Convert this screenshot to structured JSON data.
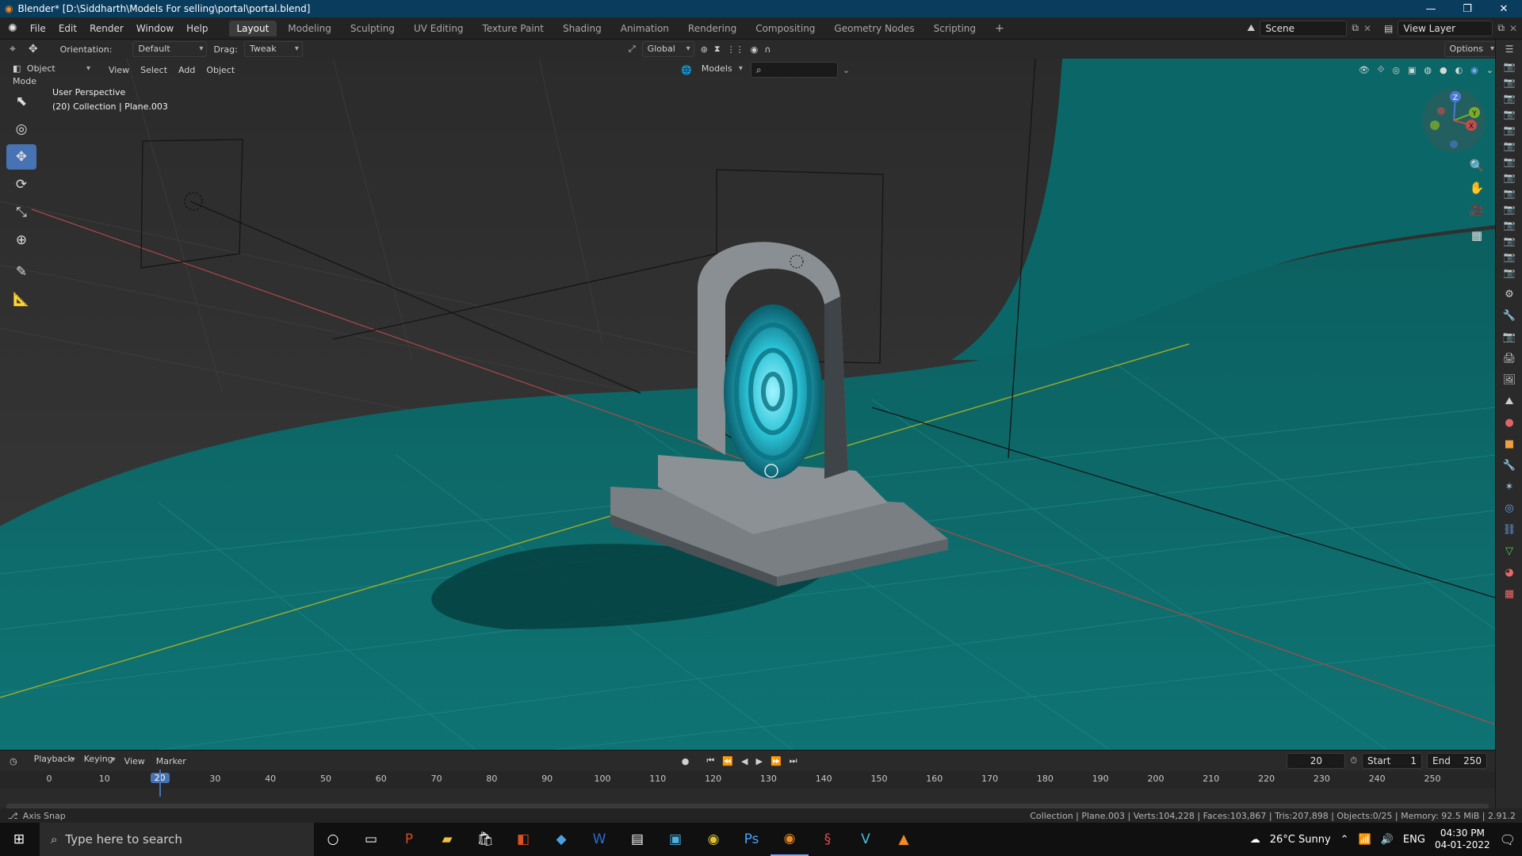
{
  "window": {
    "title": "Blender* [D:\\Siddharth\\Models For selling\\portal\\portal.blend]",
    "controls": [
      "—",
      "❐",
      "✕"
    ]
  },
  "menu": [
    "File",
    "Edit",
    "Render",
    "Window",
    "Help"
  ],
  "workspaces": [
    "Layout",
    "Modeling",
    "Sculpting",
    "UV Editing",
    "Texture Paint",
    "Shading",
    "Animation",
    "Rendering",
    "Compositing",
    "Geometry Nodes",
    "Scripting"
  ],
  "active_workspace": "Layout",
  "scene": {
    "name": "Scene",
    "view_layer": "View Layer"
  },
  "tool_header": {
    "orientation_label": "Orientation:",
    "orientation_value": "Default",
    "drag_label": "Drag:",
    "drag_value": "Tweak",
    "transform_orientation": "Global",
    "options": "Options"
  },
  "view_header": {
    "mode": "Object Mode",
    "menus": [
      "View",
      "Select",
      "Add",
      "Object"
    ],
    "collection_filter": "Models"
  },
  "viewport": {
    "perspective": "User Perspective",
    "info": "(20) Collection | Plane.003",
    "gizmo_axes": {
      "z": "Z",
      "y": "Y",
      "x": "X"
    }
  },
  "left_tools": [
    {
      "name": "select-tool-icon",
      "glyph": "⬉"
    },
    {
      "name": "cursor-tool-icon",
      "glyph": "◎"
    },
    {
      "name": "move-tool-icon",
      "glyph": "✥"
    },
    {
      "name": "rotate-tool-icon",
      "glyph": "⟳"
    },
    {
      "name": "scale-tool-icon",
      "glyph": "⤡"
    },
    {
      "name": "transform-tool-icon",
      "glyph": "⊕"
    },
    {
      "name": "annotate-tool-icon",
      "glyph": "✎"
    },
    {
      "name": "measure-tool-icon",
      "glyph": "📐"
    }
  ],
  "active_tool": "move-tool-icon",
  "timeline": {
    "menus": [
      "Playback",
      "Keying",
      "View",
      "Marker"
    ],
    "current_frame": "20",
    "start_label": "Start",
    "start": "1",
    "end_label": "End",
    "end": "250",
    "ticks": [
      "0",
      "10",
      "20",
      "30",
      "40",
      "50",
      "60",
      "70",
      "80",
      "90",
      "100",
      "110",
      "120",
      "130",
      "140",
      "150",
      "160",
      "170",
      "180",
      "190",
      "200",
      "210",
      "220",
      "230",
      "240",
      "250"
    ]
  },
  "statusbar": {
    "left": "Axis Snap",
    "right": "Collection | Plane.003 | Verts:104,228 | Faces:103,867 | Tris:207,898 | Objects:0/25 | Memory: 92.5 MiB | 2.91.2"
  },
  "taskbar": {
    "search_placeholder": "Type here to search",
    "weather": "26°C  Sunny",
    "lang": "ENG",
    "time": "04:30 PM",
    "date": "04-01-2022"
  },
  "colors": {
    "accent": "#4772b3",
    "floor": "#0e6b6a",
    "titlebar": "#0a3c5e"
  }
}
